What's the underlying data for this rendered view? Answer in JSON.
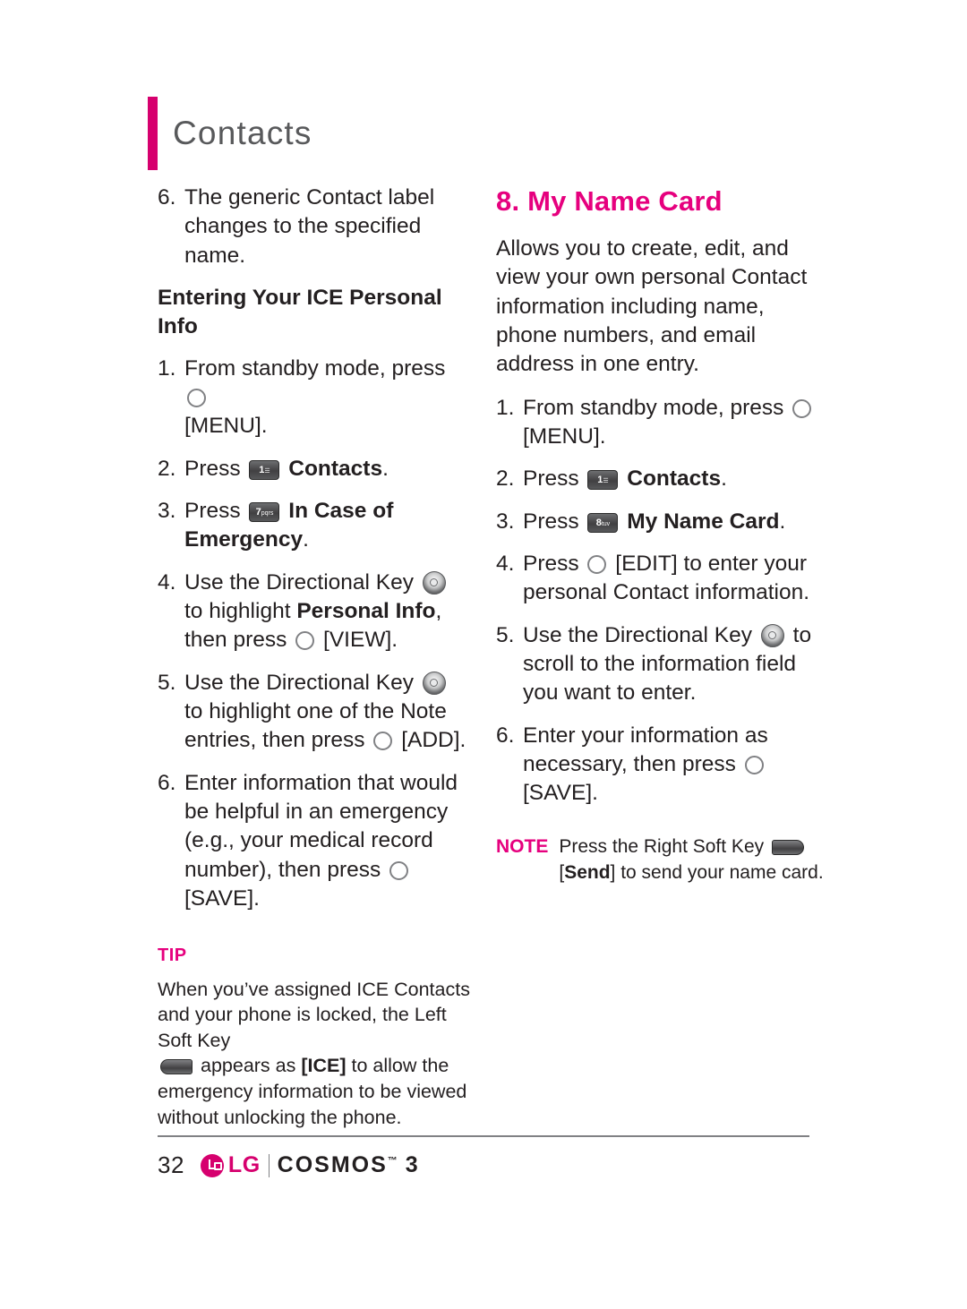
{
  "header": {
    "title": "Contacts"
  },
  "left_column": {
    "step6_prev": {
      "num": "6.",
      "text": "The generic Contact label changes to the specified name."
    },
    "subhead": "Entering Your ICE Personal Info",
    "steps": [
      {
        "num": "1.",
        "pre": "From standby mode, press",
        "icon": "round-key-icon",
        "post": "[MENU]."
      },
      {
        "num": "2.",
        "pre": "Press",
        "icon": "key-1-icon",
        "bold": "Contacts",
        "post": "."
      },
      {
        "num": "3.",
        "pre": "Press",
        "icon": "key-7-pqrs-icon",
        "bold": "In Case of Emergency",
        "post": "."
      },
      {
        "num": "4.",
        "pre": "Use the Directional Key",
        "icon": "nav-key-icon",
        "mid": "to highlight",
        "bold": "Personal Info",
        "mid2": ", then press",
        "icon2": "round-key-icon",
        "post": "[VIEW]."
      },
      {
        "num": "5.",
        "pre": "Use the Directional Key",
        "icon": "nav-key-icon",
        "mid": "to highlight one of the Note entries, then press",
        "icon2": "round-key-icon",
        "post": "[ADD]."
      },
      {
        "num": "6.",
        "pre": "Enter information that would be helpful in an emergency (e.g., your medical record number), then press",
        "icon2": "round-key-icon",
        "post": "[SAVE]."
      }
    ],
    "tip": {
      "label": "TIP",
      "part1": "When you’ve assigned ICE Contacts and your phone is locked, the Left Soft Key",
      "icon": "left-soft-key-icon",
      "part2": "appears as",
      "boxed": "[ICE]",
      "part3": "to allow the emergency information to be viewed without unlocking the phone."
    }
  },
  "right_column": {
    "section_title": "8. My Name Card",
    "intro": "Allows you to create, edit, and view your own personal Contact information including name, phone numbers, and email address in one entry.",
    "steps": [
      {
        "num": "1.",
        "pre": "From standby mode, press",
        "icon": "round-key-icon",
        "post": "[MENU]."
      },
      {
        "num": "2.",
        "pre": "Press",
        "icon": "key-1-icon",
        "bold": "Contacts",
        "post": "."
      },
      {
        "num": "3.",
        "pre": "Press",
        "icon": "key-8-tuv-icon",
        "bold": "My Name Card",
        "post": "."
      },
      {
        "num": "4.",
        "pre": "Press",
        "icon": "round-key-icon",
        "post": "[EDIT] to enter your personal Contact information."
      },
      {
        "num": "5.",
        "pre": "Use the Directional Key",
        "icon": "nav-key-icon",
        "mid": "to scroll to the information field you want to enter.",
        "post": ""
      },
      {
        "num": "6.",
        "pre": "Enter your information as necessary, then press",
        "icon2": "round-key-icon",
        "post": "[SAVE]."
      }
    ],
    "note": {
      "label": "NOTE",
      "part1": "Press the Right Soft Key",
      "icon": "right-soft-key-icon",
      "part2_open": "[",
      "part2_bold": "Send",
      "part2_close": "] to send your name card."
    }
  },
  "footer": {
    "page_number": "32",
    "brand": "LG",
    "product": "COSMOS",
    "product_sup": "™",
    "product_suffix": "3"
  },
  "keys": {
    "key1_big": "1",
    "key1_sm": "☰",
    "key7_big": "7",
    "key7_sm": "pqrs",
    "key8_big": "8",
    "key8_sm": "tuv"
  }
}
